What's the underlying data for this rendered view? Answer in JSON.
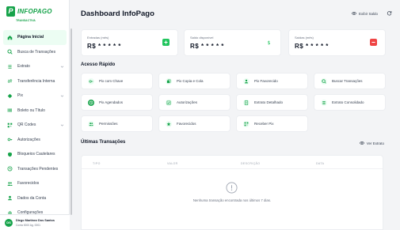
{
  "brand": {
    "name": "INFOPAGO",
    "mark": "P",
    "tagline": "TRANSACTIVA"
  },
  "nav": [
    {
      "label": "Página Inicial",
      "active": true,
      "icon": "home-icon"
    },
    {
      "label": "Busca de Transações",
      "icon": "search-icon"
    },
    {
      "label": "Extrato",
      "icon": "list-icon",
      "expandable": true
    },
    {
      "label": "Transferência Interna",
      "icon": "transfer-icon"
    },
    {
      "label": "Pix",
      "icon": "pix-icon",
      "expandable": true
    },
    {
      "label": "Boleto ou Título",
      "icon": "barcode-icon"
    },
    {
      "label": "QR Codes",
      "icon": "qrcode-icon",
      "expandable": true
    },
    {
      "label": "Autorizações",
      "icon": "key-icon"
    },
    {
      "label": "Bloqueios Cautelares",
      "icon": "shield-icon"
    },
    {
      "label": "Transações Pendentes",
      "icon": "clock-icon"
    },
    {
      "label": "Favorecidos",
      "icon": "users-icon"
    },
    {
      "label": "Dados da Conta",
      "icon": "user-icon"
    },
    {
      "label": "Configurações",
      "icon": "gear-icon"
    }
  ],
  "user": {
    "initials": "DS",
    "name": "Diego Martinez Dos Santos",
    "account": "Conta 0000 Ag. 0001"
  },
  "header": {
    "title": "Dashboard InfoPago",
    "show_balance": "Exibir Saldo"
  },
  "cards": [
    {
      "label": "Entradas (mês)",
      "value": "R$ * * * * *",
      "icon": "plus-icon",
      "color": "#22c55e"
    },
    {
      "label": "Saldo disponível",
      "value": "R$ * * * * *",
      "icon": "dollar-icon",
      "color": "#22c55e"
    },
    {
      "label": "Saídas (mês)",
      "value": "R$ * * * * *",
      "icon": "minus-icon",
      "color": "#ef4444"
    }
  ],
  "quick_access": {
    "title": "Acesso Rápido",
    "items": [
      {
        "label": "Pix com Chave",
        "icon": "key-icon"
      },
      {
        "label": "Pix Copia e Cola",
        "icon": "copy-icon"
      },
      {
        "label": "Pix Favorecido",
        "icon": "user-icon"
      },
      {
        "label": "Buscar Transações",
        "icon": "search-icon"
      },
      {
        "label": "Pix Agendados",
        "icon": "clock-icon"
      },
      {
        "label": "Autorizações",
        "icon": "check-icon"
      },
      {
        "label": "Extrato Detalhado",
        "icon": "doc-icon"
      },
      {
        "label": "Extrato Consolidado",
        "icon": "list-icon"
      },
      {
        "label": "Permissões",
        "icon": "users-icon"
      },
      {
        "label": "Favorecidos",
        "icon": "star-icon"
      },
      {
        "label": "Receber Pix",
        "icon": "qrcode-icon"
      }
    ]
  },
  "transactions": {
    "title": "Últimas Transações",
    "view_statement": "Ver Extrato",
    "columns": [
      "TIPO",
      "VALOR",
      "DESCRIÇÃO",
      "DATA"
    ],
    "empty_text": "Nenhuma transação encontrada nos últimos 7 dias."
  },
  "colors": {
    "accent": "#16a34a",
    "accent_light": "#ecfdf3",
    "danger": "#ef4444"
  }
}
